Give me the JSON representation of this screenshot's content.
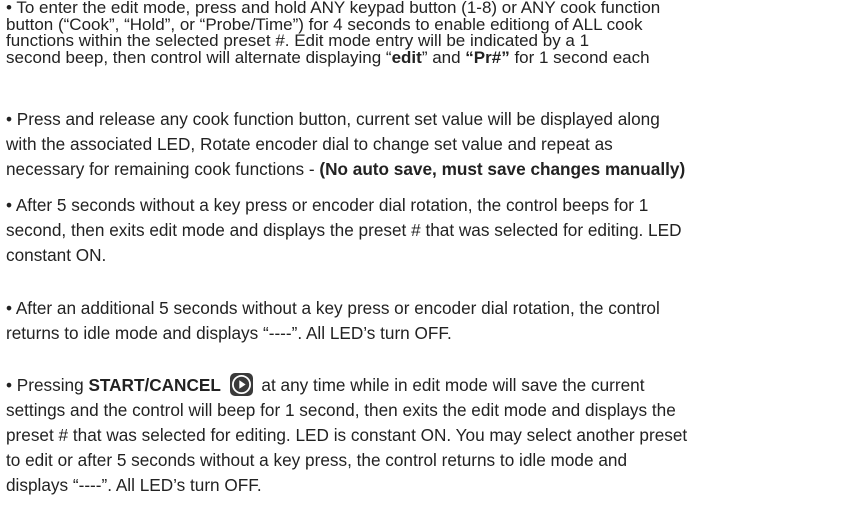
{
  "paragraphs": {
    "p1": {
      "l1": "• To enter the edit mode, press and hold ANY keypad button (1-8) or ANY cook function",
      "l2": "button (“Cook”, “Hold”, or “Probe/Time”) for 4 seconds to enable editiong of ALL cook",
      "l3": "functions within the selected preset #. Edit mode entry will be indicated by a 1",
      "l4_a": "second beep, then control will alternate displaying “",
      "l4_b": "edit",
      "l4_c": "” and ",
      "l4_d": "“Pr#”",
      "l4_e": " for 1 second each"
    },
    "p2": {
      "l1": "• Press and release any cook function button, current set value will be displayed along",
      "l2": "with the associated LED, Rotate encoder dial to change set value and repeat as",
      "l3_a": "necessary for remaining cook functions - ",
      "l3_b": "(No auto save, must save changes manually)"
    },
    "p3": {
      "l1": "• After 5 seconds without a key press or encoder dial rotation, the control beeps for 1",
      "l2": "second, then exits edit mode and displays the preset # that was selected for editing. LED",
      "l3": "constant ON."
    },
    "p4": {
      "l1": "• After an additional 5 seconds without a key press or encoder dial rotation, the control",
      "l2": "returns to idle mode and displays “----”. All LED’s turn OFF."
    },
    "p5": {
      "l1_a": "• Pressing ",
      "l1_b": "START/CANCEL",
      "l1_c": "  at any time while in edit mode will save the current",
      "l2": "settings and the control will beep for 1 second, then exits the edit mode and displays the",
      "l3": "preset # that was selected for editing. LED is constant ON. You may select another preset",
      "l4": "to edit or after 5 seconds without a key press, the control returns to idle mode and",
      "l5": "displays “----”. All LED’s turn OFF."
    }
  },
  "icons": {
    "start_cancel": "play-button-icon"
  },
  "colors": {
    "text": "#222222",
    "icon_bg": "#3a3a3a",
    "icon_fg": "#ffffff"
  }
}
